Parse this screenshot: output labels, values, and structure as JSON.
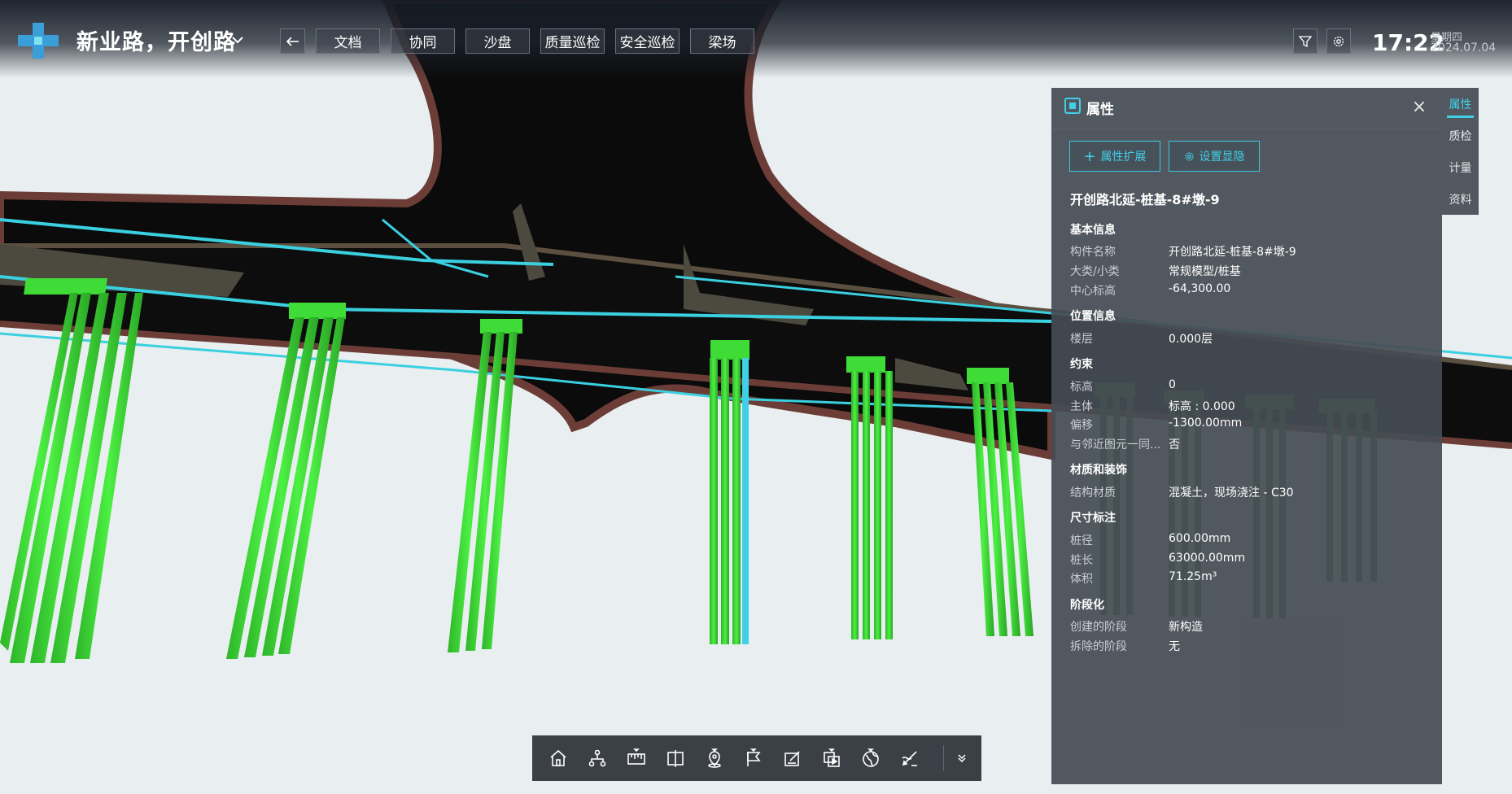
{
  "header": {
    "project_title": "新业路，开创路",
    "nav": [
      {
        "label": "文档"
      },
      {
        "label": "协同"
      },
      {
        "label": "沙盘"
      },
      {
        "label": "质量巡检"
      },
      {
        "label": "安全巡检"
      },
      {
        "label": "梁场"
      }
    ],
    "back_icon": "arrow-left-icon",
    "filter_icon": "filter-icon",
    "settings_icon": "gear-icon",
    "time": "17:22",
    "weekday": "星期四",
    "date": "2024.07.04"
  },
  "panel": {
    "title": "属性",
    "buttons": {
      "extend": "属性扩展",
      "visibility": "设置显隐"
    },
    "element_title": "开创路北延-桩基-8#墩-9",
    "sections": [
      {
        "heading": "基本信息",
        "rows": [
          {
            "label": "构件名称",
            "value": "开创路北延-桩基-8#墩-9"
          },
          {
            "label": "大类/小类",
            "value": "常规模型/桩基"
          },
          {
            "label": "中心标高",
            "value": "-64,300.00"
          }
        ]
      },
      {
        "heading": "位置信息",
        "rows": [
          {
            "label": "楼层",
            "value": "0.000层"
          }
        ]
      },
      {
        "heading": "约束",
        "rows": [
          {
            "label": "标高",
            "value": "0"
          },
          {
            "label": "主体",
            "value": "标高 : 0.000"
          },
          {
            "label": "偏移",
            "value": "-1300.00mm"
          },
          {
            "label": "与邻近图元一同...",
            "value": "否"
          }
        ]
      },
      {
        "heading": "材质和装饰",
        "rows": [
          {
            "label": "结构材质",
            "value": "混凝土，现场浇注 - C30"
          }
        ]
      },
      {
        "heading": "尺寸标注",
        "rows": [
          {
            "label": "桩径",
            "value": "600.00mm"
          },
          {
            "label": "桩长",
            "value": "63000.00mm"
          },
          {
            "label": "体积",
            "value": "71.25m³"
          }
        ]
      },
      {
        "heading": "阶段化",
        "rows": [
          {
            "label": "创建的阶段",
            "value": "新构造"
          },
          {
            "label": "拆除的阶段",
            "value": "无"
          }
        ]
      }
    ]
  },
  "side_tabs": [
    {
      "label": "属性",
      "active": true
    },
    {
      "label": "质检",
      "active": false
    },
    {
      "label": "计量",
      "active": false
    },
    {
      "label": "资料",
      "active": false
    }
  ],
  "toolbar": {
    "tools": [
      {
        "icon": "home-icon"
      },
      {
        "icon": "structure-tree-icon"
      },
      {
        "icon": "measure-ruler-icon"
      },
      {
        "icon": "section-box-icon"
      },
      {
        "icon": "map-pin-icon"
      },
      {
        "icon": "flag-icon"
      },
      {
        "icon": "edit-note-icon"
      },
      {
        "icon": "video-copy-icon"
      },
      {
        "icon": "globe-icon"
      },
      {
        "icon": "draw-pen-icon"
      }
    ],
    "collapse_icon": "double-chevron-down-icon"
  },
  "colors": {
    "accent": "#3fd0e8",
    "pile_green": "#3ee83a",
    "road_dark": "#0c0c0c",
    "road_edge": "#6a3a34"
  }
}
